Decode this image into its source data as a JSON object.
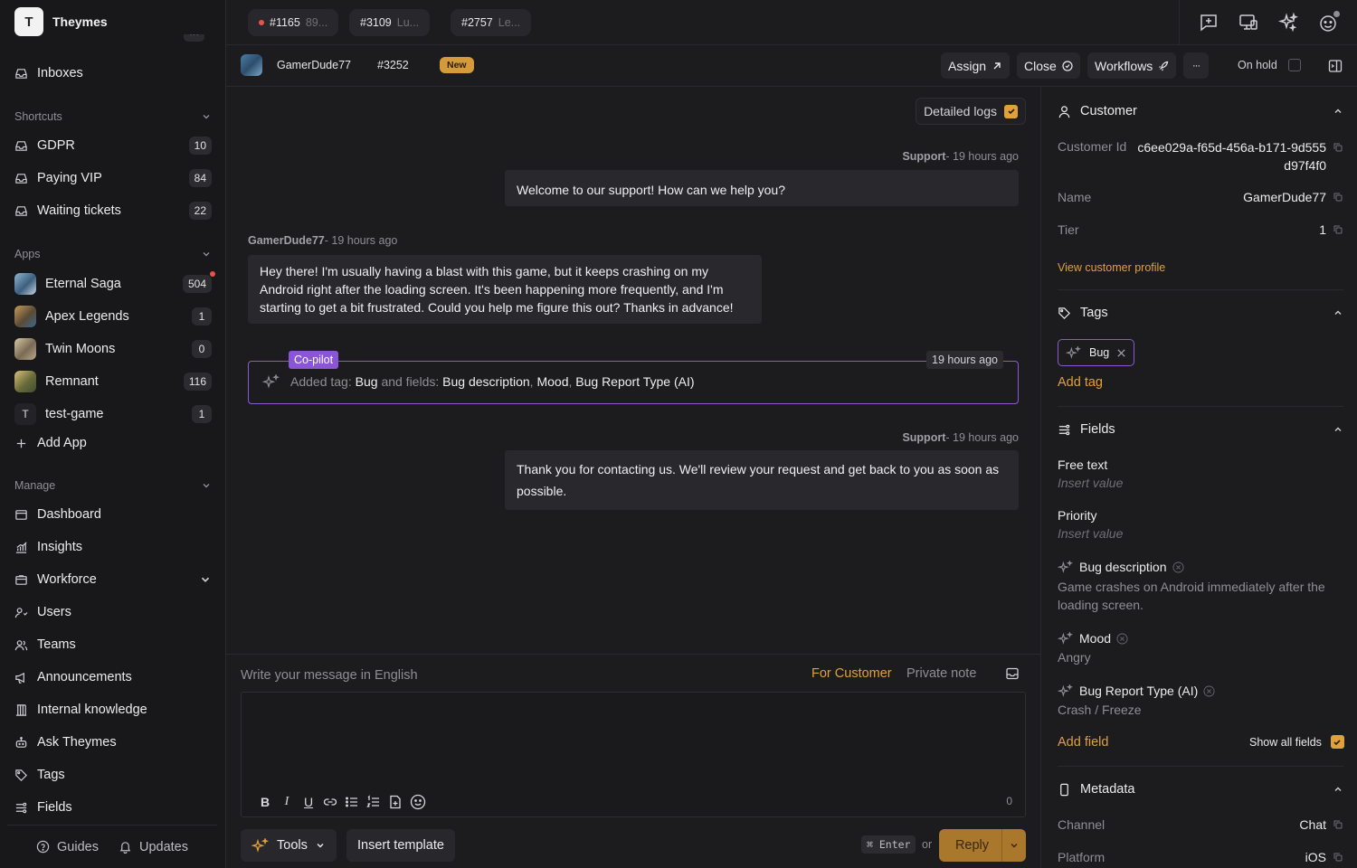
{
  "sidebar": {
    "brand": {
      "logo_letter": "T",
      "name": "Theymes"
    },
    "inboxes_label": "Inboxes",
    "shortcuts": {
      "title": "Shortcuts",
      "items": [
        {
          "label": "GDPR",
          "count": "10"
        },
        {
          "label": "Paying VIP",
          "count": "84"
        },
        {
          "label": "Waiting tickets",
          "count": "22"
        }
      ]
    },
    "apps": {
      "title": "Apps",
      "items": [
        {
          "label": "Eternal Saga",
          "count": "504",
          "notification": true,
          "color": "#5a7d9a"
        },
        {
          "label": "Apex Legends",
          "count": "1",
          "color": "#7b5a3a"
        },
        {
          "label": "Twin Moons",
          "count": "0",
          "color": "#7a6a55"
        },
        {
          "label": "Remnant",
          "count": "116",
          "color": "#8a7a3a"
        },
        {
          "label": "test-game",
          "count": "1",
          "letter": "T"
        }
      ],
      "add_label": "Add App"
    },
    "manage": {
      "title": "Manage",
      "items": [
        {
          "label": "Dashboard",
          "icon": "dashboard-icon"
        },
        {
          "label": "Insights",
          "icon": "insights-icon"
        },
        {
          "label": "Workforce",
          "icon": "workforce-icon",
          "expandable": true
        },
        {
          "label": "Users",
          "icon": "users-icon"
        },
        {
          "label": "Teams",
          "icon": "teams-icon"
        },
        {
          "label": "Announcements",
          "icon": "megaphone-icon"
        },
        {
          "label": "Internal knowledge",
          "icon": "library-icon"
        },
        {
          "label": "Ask Theymes",
          "icon": "robot-icon"
        },
        {
          "label": "Tags",
          "icon": "tag-icon"
        },
        {
          "label": "Fields",
          "icon": "fields-icon"
        }
      ]
    },
    "footer": {
      "guides": "Guides",
      "updates": "Updates"
    }
  },
  "tabs": [
    {
      "id": "#1165",
      "preview": "89...",
      "unread": true
    },
    {
      "id": "#3109",
      "preview": "Lu..."
    },
    {
      "id": "#2757",
      "preview": "Le..."
    }
  ],
  "ticket": {
    "user": "GamerDude77",
    "id": "#3252",
    "status": "New",
    "actions": {
      "assign": "Assign",
      "close": "Close",
      "workflows": "Workflows",
      "more": "···"
    },
    "on_hold_label": "On hold"
  },
  "conversation": {
    "detailed_logs_label": "Detailed logs",
    "messages": [
      {
        "author": "Support",
        "time": "19 hours ago",
        "text": "Welcome to our support! How can we help you?"
      },
      {
        "author": "GamerDude77",
        "time": "19 hours ago",
        "text": "Hey there! I'm usually having a blast with this game, but it keeps crashing on my Android right after the loading screen. It's been happening more frequently, and I'm starting to get a bit frustrated. Could you help me figure this out? Thanks in advance!"
      },
      {
        "author": "Support",
        "time": "19 hours ago",
        "text": "Thank you for contacting us. We'll review your request and get back to you as soon as possible."
      }
    ],
    "copilot": {
      "label": "Co-pilot",
      "time": "19 hours ago",
      "prefix": "Added tag:",
      "tag": "Bug",
      "middle": "and fields:",
      "fields": [
        "Bug description",
        "Mood",
        "Bug Report Type (AI)"
      ]
    }
  },
  "composer": {
    "placeholder": "Write your message in English",
    "for_customer": "For Customer",
    "private_note": "Private note",
    "char_count": "0",
    "tools_label": "Tools",
    "insert_template_label": "Insert template",
    "shortcut": "⌘ Enter",
    "or_label": "or",
    "reply_label": "Reply"
  },
  "panel": {
    "customer": {
      "title": "Customer",
      "customer_id_label": "Customer Id",
      "customer_id_line1": "c6ee029a-f65d-456a-b171-9d555",
      "customer_id_line2": "d97f4f0",
      "name_label": "Name",
      "name_value": "GamerDude77",
      "tier_label": "Tier",
      "tier_value": "1",
      "profile_link": "View customer profile"
    },
    "tags": {
      "title": "Tags",
      "items": [
        "Bug"
      ],
      "add_label": "Add tag"
    },
    "fields": {
      "title": "Fields",
      "free_text_label": "Free text",
      "free_text_value": "Insert value",
      "priority_label": "Priority",
      "priority_value": "Insert value",
      "bug_description_label": "Bug description",
      "bug_description_value": "Game crashes on Android immediately after the loading screen.",
      "mood_label": "Mood",
      "mood_value": "Angry",
      "bug_type_label": "Bug Report Type (AI)",
      "bug_type_value": "Crash / Freeze",
      "add_label": "Add field",
      "show_all_label": "Show all fields"
    },
    "metadata": {
      "title": "Metadata",
      "channel_label": "Channel",
      "channel_value": "Chat",
      "platform_label": "Platform",
      "platform_value": "iOS"
    }
  },
  "colors": {
    "accent": "#e0a13a",
    "copilot": "#8a55d6",
    "new_badge": "#d59b3a",
    "unread_dot": "#e5534b"
  }
}
